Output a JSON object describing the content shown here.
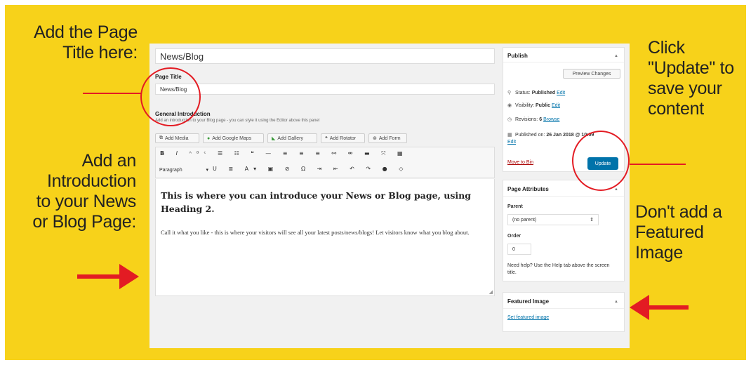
{
  "annotations": {
    "title_tip": "Add the Page\nTitle here:",
    "intro_tip": "Add an\nIntroduction\nto your News\nor Blog Page:",
    "update_tip": "Click\n\"Update\" to\nsave your\ncontent",
    "featured_tip": "Don't add a\nFeatured\nImage"
  },
  "editor": {
    "post_title": "News/Blog",
    "page_title_label": "Page Title",
    "page_title_value": "News/Blog",
    "intro_label": "General Introduction",
    "intro_desc": "Add an introduction to your Blog page - you can style it using the Editor above this panel",
    "media_buttons": [
      "Add Media",
      "Add Google Maps",
      "Add Gallery",
      "Add Rotator",
      "Add Form"
    ],
    "format_select": "Paragraph",
    "heading": "This is where you can introduce your News or Blog page, using Heading 2.",
    "body": "Call it what you like - this is where your visitors will see all your latest posts/news/blogs! Let visitors know what you blog about."
  },
  "publish": {
    "title": "Publish",
    "preview_label": "Preview Changes",
    "status_label": "Status:",
    "status_value": "Published",
    "visibility_label": "Visibility:",
    "visibility_value": "Public",
    "revisions_label": "Revisions:",
    "revisions_value": "6",
    "browse_label": "Browse",
    "published_label": "Published on:",
    "published_value": "26 Jan 2018 @ 10:09",
    "edit_label": "Edit",
    "move_to_bin": "Move to Bin",
    "update_label": "Update"
  },
  "attributes": {
    "title": "Page Attributes",
    "parent_label": "Parent",
    "parent_value": "(no parent)",
    "order_label": "Order",
    "order_value": "0",
    "help_text": "Need help? Use the Help tab above the screen title."
  },
  "featured": {
    "title": "Featured Image",
    "set_link": "Set featured image"
  },
  "colors": {
    "accent": "#e31b23",
    "background": "#f7d21a",
    "wp_blue": "#0073aa"
  }
}
